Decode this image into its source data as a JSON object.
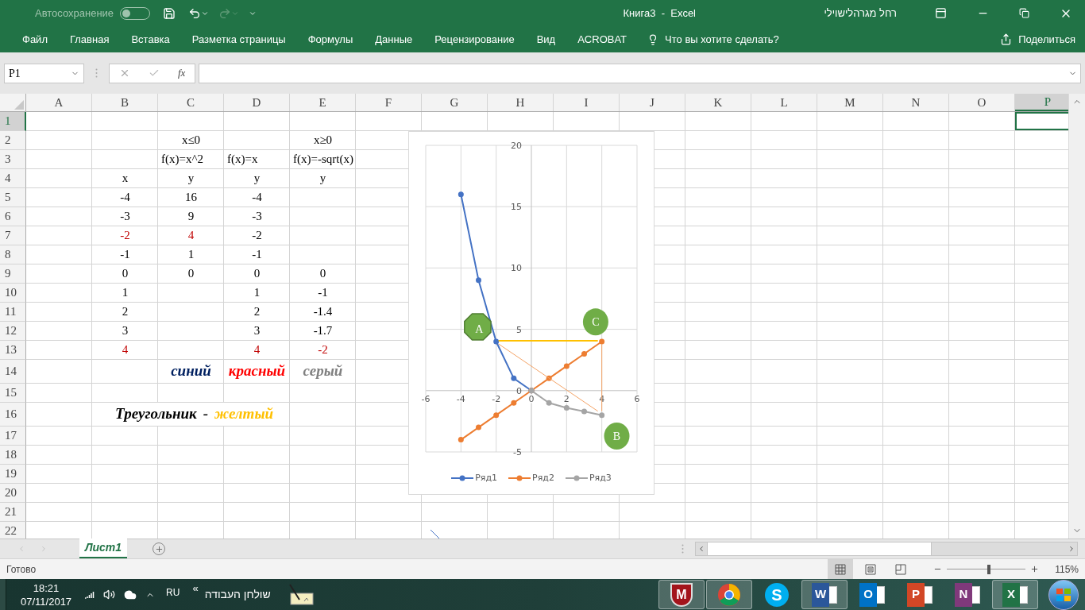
{
  "title_bar": {
    "autosave": {
      "label": "Автосохранение",
      "on": false
    },
    "redo_disabled": true,
    "title": "Книга3  -  Excel",
    "user": "רחל מגרהלישוילי"
  },
  "ribbon": {
    "tabs": [
      "Файл",
      "Главная",
      "Вставка",
      "Разметка страницы",
      "Формулы",
      "Данные",
      "Рецензирование",
      "Вид",
      "ACROBAT"
    ],
    "tell_me": "Что вы хотите сделать?",
    "share": "Поделиться"
  },
  "formula_bar": {
    "name_box": "P1",
    "fx": "fx",
    "enter_disabled": true
  },
  "sheet": {
    "columns": [
      {
        "label": "A",
        "selected": false
      },
      {
        "label": "B",
        "selected": false
      },
      {
        "label": "C",
        "selected": false
      },
      {
        "label": "D",
        "selected": false
      },
      {
        "label": "E",
        "selected": false
      },
      {
        "label": "F",
        "selected": false
      },
      {
        "label": "G",
        "selected": false
      },
      {
        "label": "H",
        "selected": false
      },
      {
        "label": "I",
        "selected": false
      },
      {
        "label": "J",
        "selected": false
      },
      {
        "label": "K",
        "selected": false
      },
      {
        "label": "L",
        "selected": false
      },
      {
        "label": "M",
        "selected": false
      },
      {
        "label": "N",
        "selected": false
      },
      {
        "label": "O",
        "selected": false
      },
      {
        "label": "P",
        "selected": true
      }
    ],
    "rows": [
      {
        "number": "1",
        "selected": true
      },
      {
        "number": "2",
        "selected": false,
        "cells": [
          null,
          null,
          {
            "text": "x≤0"
          },
          null,
          {
            "text": "x≥0"
          }
        ]
      },
      {
        "number": "3",
        "selected": false,
        "cells": [
          null,
          null,
          {
            "text": "f(x)=x^2",
            "kind": "formula"
          },
          {
            "text": "f(x)=x",
            "kind": "formula"
          },
          {
            "text": "f(x)=-sqrt(x)",
            "kind": "formula"
          }
        ]
      },
      {
        "number": "4",
        "selected": false,
        "cells": [
          null,
          {
            "text": "x"
          },
          {
            "text": "y"
          },
          {
            "text": "y"
          },
          {
            "text": "y"
          }
        ]
      },
      {
        "number": "5",
        "selected": false,
        "cells": [
          null,
          {
            "text": "-4"
          },
          {
            "text": "16"
          },
          {
            "text": "-4"
          }
        ]
      },
      {
        "number": "6",
        "selected": false,
        "cells": [
          null,
          {
            "text": "-3"
          },
          {
            "text": "9"
          },
          {
            "text": "-3"
          }
        ]
      },
      {
        "number": "7",
        "selected": false,
        "cells": [
          null,
          {
            "text": "-2",
            "color": "#c00000"
          },
          {
            "text": "4",
            "color": "#c00000"
          },
          {
            "text": "-2"
          }
        ]
      },
      {
        "number": "8",
        "selected": false,
        "cells": [
          null,
          {
            "text": "-1"
          },
          {
            "text": "1"
          },
          {
            "text": "-1"
          }
        ]
      },
      {
        "number": "9",
        "selected": false,
        "cells": [
          null,
          {
            "text": "0"
          },
          {
            "text": "0"
          },
          {
            "text": "0"
          },
          {
            "text": "0"
          }
        ]
      },
      {
        "number": "10",
        "selected": false,
        "cells": [
          null,
          {
            "text": "1"
          },
          null,
          {
            "text": "1"
          },
          {
            "text": "-1"
          }
        ]
      },
      {
        "number": "11",
        "selected": false,
        "cells": [
          null,
          {
            "text": "2"
          },
          null,
          {
            "text": "2"
          },
          {
            "text": "-1.4"
          }
        ]
      },
      {
        "number": "12",
        "selected": false,
        "cells": [
          null,
          {
            "text": "3"
          },
          null,
          {
            "text": "3"
          },
          {
            "text": "-1.7"
          }
        ]
      },
      {
        "number": "13",
        "selected": false,
        "cells": [
          null,
          {
            "text": "4",
            "color": "#c00000"
          },
          null,
          {
            "text": "4",
            "color": "#c00000"
          },
          {
            "text": "-2",
            "color": "#c00000"
          }
        ]
      },
      {
        "number": "14",
        "selected": false,
        "cells": [
          null,
          null,
          {
            "text": "синий",
            "color": "#002060",
            "kind": "emphasis"
          },
          {
            "text": "красный",
            "color": "#ff0000",
            "kind": "emphasis"
          },
          {
            "text": "серый",
            "color": "#808080",
            "kind": "emphasis"
          }
        ]
      },
      {
        "number": "15",
        "selected": false
      },
      {
        "number": "16",
        "selected": false,
        "cells": [
          null,
          {
            "kind": "emphasis",
            "parts": [
              {
                "text": "Треугольник",
                "color": "#000000"
              },
              {
                "text": "-",
                "color": "#000000"
              },
              {
                "text": "желтый",
                "color": "#ffc000"
              }
            ]
          }
        ]
      },
      {
        "number": "17",
        "selected": false
      },
      {
        "number": "18",
        "selected": false
      },
      {
        "number": "19",
        "selected": false
      },
      {
        "number": "20",
        "selected": false
      },
      {
        "number": "21",
        "selected": false
      },
      {
        "number": "22",
        "selected": false
      }
    ]
  },
  "chart": {
    "chart_data": {
      "type": "line",
      "x": [
        -4,
        -3,
        -2,
        -1,
        0,
        1,
        2,
        3,
        4
      ],
      "series": [
        {
          "name": "Ряд1",
          "color": "#4472c4",
          "marker": "circle",
          "values": [
            16,
            9,
            4,
            1,
            0,
            null,
            null,
            null,
            null
          ]
        },
        {
          "name": "Ряд2",
          "color": "#ed7d31",
          "marker": "circle",
          "values": [
            -4,
            -3,
            -2,
            -1,
            0,
            1,
            2,
            3,
            4
          ]
        },
        {
          "name": "Ряд3",
          "color": "#a5a5a5",
          "marker": "circle",
          "values": [
            null,
            null,
            null,
            null,
            0,
            -1,
            -1.4,
            -1.7,
            -2
          ]
        }
      ],
      "xlim": [
        -6,
        6
      ],
      "ylim": [
        -5,
        20
      ],
      "xticks": [
        {
          "value": -6,
          "label": "-6"
        },
        {
          "value": -4,
          "label": "-4"
        },
        {
          "value": -2,
          "label": "-2"
        },
        {
          "value": 0,
          "label": "0"
        },
        {
          "value": 2,
          "label": "2"
        },
        {
          "value": 4,
          "label": "4"
        },
        {
          "value": 6,
          "label": "6"
        }
      ],
      "yticks": [
        {
          "value": -5,
          "label": "-5"
        },
        {
          "value": 0,
          "label": "0"
        },
        {
          "value": 5,
          "label": "5"
        },
        {
          "value": 10,
          "label": "10"
        },
        {
          "value": 15,
          "label": "15"
        },
        {
          "value": 20,
          "label": "20"
        }
      ],
      "grid": true,
      "legend": "bottom"
    },
    "shapes": [
      {
        "kind": "octagon",
        "text": "A"
      },
      {
        "kind": "circle",
        "text": "C"
      },
      {
        "kind": "circle",
        "text": "B"
      }
    ]
  },
  "sheet_tabs": [
    {
      "label": "Лист1",
      "selected": true
    }
  ],
  "status_bar": {
    "status": "Готово",
    "views": [
      {
        "kind": "normal",
        "selected": true
      },
      {
        "kind": "page-layout",
        "selected": false
      },
      {
        "kind": "page-break",
        "selected": false
      }
    ],
    "zoom": {
      "level": 0.53,
      "reading": "115%"
    }
  },
  "taskbar": {
    "time": "18:21",
    "date": "07/11/2017",
    "language": "RU",
    "toolbar_chevron": "«",
    "toolbar_label": "שולחן העבודה",
    "apps": [
      {
        "kind": "shield",
        "glyph": "M",
        "running": true
      },
      {
        "kind": "chrome",
        "running": true
      },
      {
        "kind": "skype",
        "glyph": "S",
        "running": false
      },
      {
        "kind": "word",
        "glyph": "W",
        "running": true
      },
      {
        "kind": "outlook",
        "glyph": "O",
        "running": false
      },
      {
        "kind": "powerpoint",
        "glyph": "P",
        "running": false
      },
      {
        "kind": "onenote",
        "glyph": "N",
        "running": false
      },
      {
        "kind": "excel",
        "glyph": "X",
        "running": true
      }
    ]
  }
}
